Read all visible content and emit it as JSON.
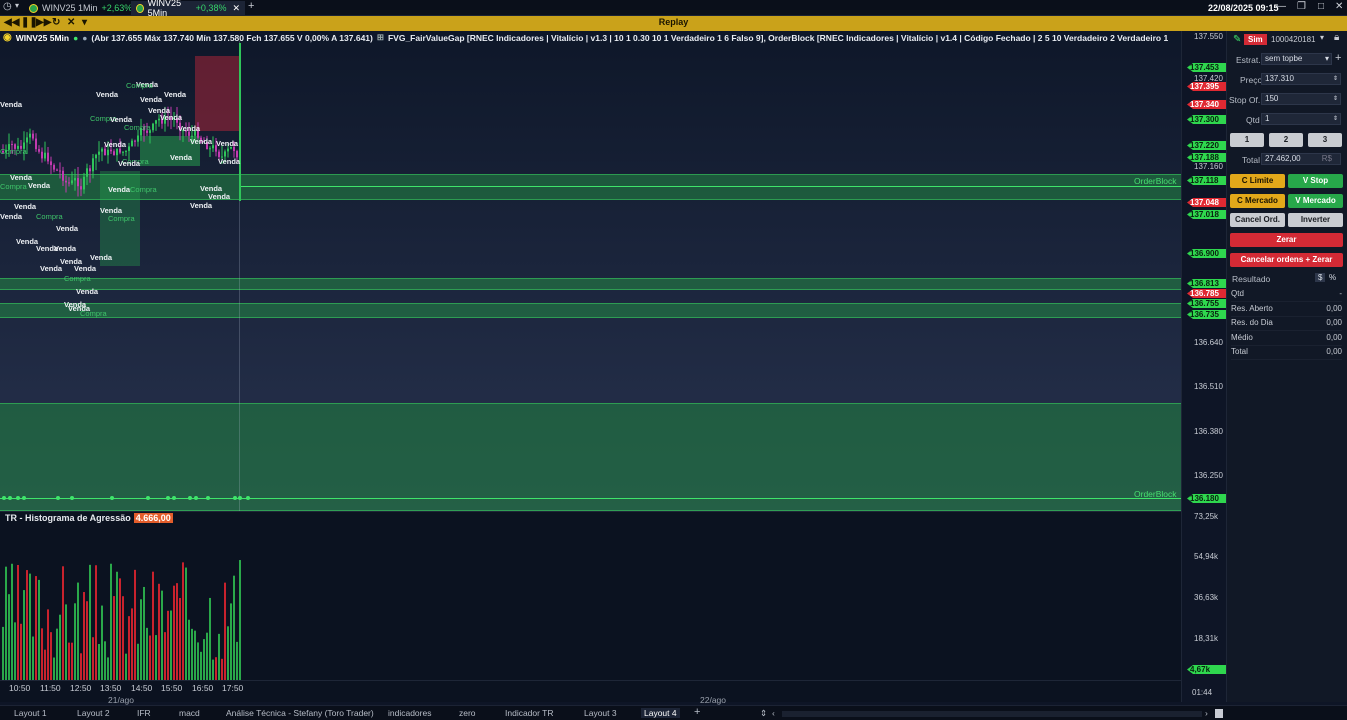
{
  "tabs": [
    {
      "symbol": "WINV25 1Min",
      "change": "+2,63%"
    },
    {
      "symbol": "WINV25 5Min",
      "change": "+0,38%"
    }
  ],
  "datetime": "22/08/2025 09:15",
  "replay_label": "Replay",
  "info": {
    "symbol": "WINV25 5Min",
    "ohlc": "(Abr 137.655 Máx 137.740 Mín 137.580 Fch 137.655 V 0,00% A 137.641)",
    "indicators": "FVG_FairValueGap [RNEC Indicadores | Vitalício | v1.3 | 10 1 0.30 10 1  Verdadeiro 1 6 Falso 9], OrderBlock [RNEC Indicadores | Vitalício | v1.4 | Código Fechado | 2 5 10 Verdadeiro 2 Verdadeiro 1"
  },
  "orderblock_label": "OrderBlock",
  "candle_labels": {
    "sell": "Venda",
    "buy": "Compra"
  },
  "price_ticks": [
    "137.550",
    "137.420",
    "137.160",
    "136.640",
    "136.510",
    "136.380",
    "136.250"
  ],
  "price_badges": [
    {
      "text": "137.453",
      "color": "green"
    },
    {
      "text": "137.395",
      "color": "red"
    },
    {
      "text": "137.340",
      "color": "red"
    },
    {
      "text": "137.300",
      "color": "green"
    },
    {
      "text": "137.220",
      "color": "green"
    },
    {
      "text": "137.188",
      "color": "green"
    },
    {
      "text": "137.118",
      "color": "green"
    },
    {
      "text": "137.048",
      "color": "red"
    },
    {
      "text": "137.018",
      "color": "green"
    },
    {
      "text": "136.900",
      "color": "green"
    },
    {
      "text": "136.813",
      "color": "green"
    },
    {
      "text": "136.785",
      "color": "red"
    },
    {
      "text": "136.755",
      "color": "green"
    },
    {
      "text": "136.735",
      "color": "green"
    },
    {
      "text": "136.180",
      "color": "green"
    }
  ],
  "histogram": {
    "title": "TR - Histograma de Agressão",
    "value": "4.666,00",
    "ticks": [
      "73,25k",
      "54,94k",
      "36,63k",
      "18,31k"
    ],
    "last": "4,67k"
  },
  "time_labels": [
    "10:50",
    "11:50",
    "12:50",
    "13:50",
    "14:50",
    "15:50",
    "16:50",
    "17:50"
  ],
  "date_labels": [
    "21/ago",
    "22/ago"
  ],
  "clock": "01:44",
  "panel": {
    "mode": "Sim",
    "account": "1000420181",
    "strat_label": "Estrat.",
    "strat_value": "sem topbe",
    "price_label": "Preço",
    "price_value": "137.310",
    "stop_label": "Stop Of.",
    "stop_value": "150",
    "qty_label": "Qtd",
    "qty_value": "1",
    "quick_qty": [
      "1",
      "2",
      "3"
    ],
    "total_label": "Total",
    "total_value": "27.462,00",
    "currency": "R$",
    "btn_c_limite": "C Limite",
    "btn_v_stop": "V Stop",
    "btn_c_mercado": "C Mercado",
    "btn_v_mercado": "V Mercado",
    "btn_cancel": "Cancel Ord.",
    "btn_inverter": "Inverter",
    "btn_zerar": "Zerar",
    "btn_cancel_zerar": "Cancelar ordens + Zerar",
    "result_label": "Resultado",
    "result_dollar": "$",
    "result_pct": "%",
    "rows": [
      {
        "k": "Qtd",
        "v": "-"
      },
      {
        "k": "Res. Aberto",
        "v": "0,00"
      },
      {
        "k": "Res. do Dia",
        "v": "0,00"
      },
      {
        "k": "Médio",
        "v": "0,00"
      },
      {
        "k": "Total",
        "v": "0,00"
      }
    ]
  },
  "layouts": [
    "Layout 1",
    "Layout 2",
    "IFR",
    "macd",
    "Análise Técnica - Stefany (Toro Trader)",
    "indicadores",
    "zero",
    "Indicador TR",
    "Layout 3",
    "Layout 4"
  ]
}
